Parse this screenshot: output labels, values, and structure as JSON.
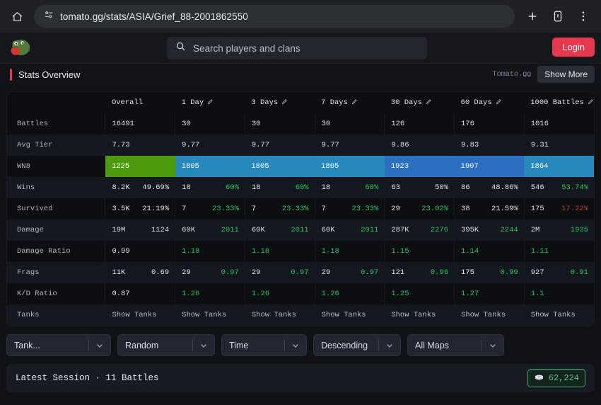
{
  "browser": {
    "url": "tomato.gg/stats/ASIA/Grief_88-2001862550",
    "home_icon": "home-icon",
    "site_settings_icon": "site-settings-icon",
    "new_tab_icon": "plus-icon",
    "reader_icon": "reader-mode-icon",
    "menu_icon": "kebab-menu-icon"
  },
  "header": {
    "logo_alt": "tomato-logo",
    "search_placeholder": "Search players and clans",
    "search_value": "",
    "search_icon": "search-icon",
    "login_label": "Login"
  },
  "subheader": {
    "title": "Stats Overview",
    "brand": "Tomato.gg",
    "show_more_label": "Show More"
  },
  "table": {
    "columns": [
      {
        "label": "",
        "editable": false
      },
      {
        "label": "Overall",
        "editable": false
      },
      {
        "label": "1 Day",
        "editable": true
      },
      {
        "label": "3 Days",
        "editable": true
      },
      {
        "label": "7 Days",
        "editable": true
      },
      {
        "label": "30 Days",
        "editable": true
      },
      {
        "label": "60 Days",
        "editable": true
      },
      {
        "label": "1000 Battles",
        "editable": true
      }
    ],
    "rows": [
      {
        "label": "Battles",
        "type": "plain",
        "cells": [
          {
            "left": "16491"
          },
          {
            "left": "30"
          },
          {
            "left": "30"
          },
          {
            "left": "30"
          },
          {
            "left": "126"
          },
          {
            "left": "176"
          },
          {
            "left": "1016"
          }
        ]
      },
      {
        "label": "Avg Tier",
        "type": "plain",
        "cells": [
          {
            "left": "7.73"
          },
          {
            "left": "9.77"
          },
          {
            "left": "9.77"
          },
          {
            "left": "9.77"
          },
          {
            "left": "9.86"
          },
          {
            "left": "9.83"
          },
          {
            "left": "9.31"
          }
        ]
      },
      {
        "label": "WN8",
        "type": "wn8",
        "cells": [
          {
            "left": "1225",
            "color": "#4c9b0c"
          },
          {
            "left": "1805",
            "color": "#2789bb"
          },
          {
            "left": "1805",
            "color": "#2789bb"
          },
          {
            "left": "1805",
            "color": "#2789bb"
          },
          {
            "left": "1923",
            "color": "#2a6fc0"
          },
          {
            "left": "1907",
            "color": "#2a6fc0"
          },
          {
            "left": "1864",
            "color": "#2789bb"
          }
        ]
      },
      {
        "label": "Wins",
        "type": "pair",
        "cells": [
          {
            "left": "8.2K",
            "right": "49.69%",
            "rcolor": "none"
          },
          {
            "left": "18",
            "right": "60%",
            "rcolor": "green"
          },
          {
            "left": "18",
            "right": "60%",
            "rcolor": "green"
          },
          {
            "left": "18",
            "right": "60%",
            "rcolor": "green"
          },
          {
            "left": "63",
            "right": "50%",
            "rcolor": "none"
          },
          {
            "left": "86",
            "right": "48.86%",
            "rcolor": "none"
          },
          {
            "left": "546",
            "right": "53.74%",
            "rcolor": "green"
          }
        ]
      },
      {
        "label": "Survived",
        "type": "pair",
        "cells": [
          {
            "left": "3.5K",
            "right": "21.19%",
            "rcolor": "none"
          },
          {
            "left": "7",
            "right": "23.33%",
            "rcolor": "green"
          },
          {
            "left": "7",
            "right": "23.33%",
            "rcolor": "green"
          },
          {
            "left": "7",
            "right": "23.33%",
            "rcolor": "green"
          },
          {
            "left": "29",
            "right": "23.02%",
            "rcolor": "green"
          },
          {
            "left": "38",
            "right": "21.59%",
            "rcolor": "none"
          },
          {
            "left": "175",
            "right": "17.22%",
            "rcolor": "red"
          }
        ]
      },
      {
        "label": "Damage",
        "type": "pair",
        "cells": [
          {
            "left": "19M",
            "right": "1124",
            "rcolor": "none"
          },
          {
            "left": "60K",
            "right": "2011",
            "rcolor": "green"
          },
          {
            "left": "60K",
            "right": "2011",
            "rcolor": "green"
          },
          {
            "left": "60K",
            "right": "2011",
            "rcolor": "green"
          },
          {
            "left": "287K",
            "right": "2276",
            "rcolor": "green"
          },
          {
            "left": "395K",
            "right": "2244",
            "rcolor": "green"
          },
          {
            "left": "2M",
            "right": "1935",
            "rcolor": "green"
          }
        ]
      },
      {
        "label": "Damage Ratio",
        "type": "pair",
        "cells": [
          {
            "left": "0.99",
            "right": "",
            "lcolor": "none"
          },
          {
            "left": "1.18",
            "right": "",
            "lcolor": "green"
          },
          {
            "left": "1.18",
            "right": "",
            "lcolor": "green"
          },
          {
            "left": "1.18",
            "right": "",
            "lcolor": "green"
          },
          {
            "left": "1.15",
            "right": "",
            "lcolor": "green"
          },
          {
            "left": "1.14",
            "right": "",
            "lcolor": "green"
          },
          {
            "left": "1.11",
            "right": "",
            "lcolor": "green"
          }
        ]
      },
      {
        "label": "Frags",
        "type": "pair",
        "cells": [
          {
            "left": "11K",
            "right": "0.69",
            "rcolor": "none"
          },
          {
            "left": "29",
            "right": "0.97",
            "rcolor": "green"
          },
          {
            "left": "29",
            "right": "0.97",
            "rcolor": "green"
          },
          {
            "left": "29",
            "right": "0.97",
            "rcolor": "green"
          },
          {
            "left": "121",
            "right": "0.96",
            "rcolor": "green"
          },
          {
            "left": "175",
            "right": "0.99",
            "rcolor": "green"
          },
          {
            "left": "927",
            "right": "0.91",
            "rcolor": "green"
          }
        ]
      },
      {
        "label": "K/D Ratio",
        "type": "pair",
        "cells": [
          {
            "left": "0.87",
            "right": "",
            "lcolor": "none"
          },
          {
            "left": "1.26",
            "right": "",
            "lcolor": "green"
          },
          {
            "left": "1.26",
            "right": "",
            "lcolor": "green"
          },
          {
            "left": "1.26",
            "right": "",
            "lcolor": "green"
          },
          {
            "left": "1.25",
            "right": "",
            "lcolor": "green"
          },
          {
            "left": "1.27",
            "right": "",
            "lcolor": "green"
          },
          {
            "left": "1.1",
            "right": "",
            "lcolor": "green"
          }
        ]
      },
      {
        "label": "Tanks",
        "type": "link",
        "cells": [
          {
            "left": "Show Tanks"
          },
          {
            "left": "Show Tanks"
          },
          {
            "left": "Show Tanks"
          },
          {
            "left": "Show Tanks"
          },
          {
            "left": "Show Tanks"
          },
          {
            "left": "Show Tanks"
          },
          {
            "left": "Show Tanks"
          }
        ]
      }
    ]
  },
  "filters": [
    {
      "name": "tank-filter",
      "value": "Tank..."
    },
    {
      "name": "mode-filter",
      "value": "Random"
    },
    {
      "name": "sort-filter",
      "value": "Time"
    },
    {
      "name": "order-filter",
      "value": "Descending"
    },
    {
      "name": "map-filter",
      "value": "All Maps"
    }
  ],
  "session": {
    "title": "Latest Session · 11 Battles",
    "credits": "62,224",
    "credits_icon": "silver-credits-icon"
  },
  "colors": {
    "accent_red": "#e8384f",
    "green": "#22c55e",
    "red": "#c0392b",
    "wn8_green": "#4c9b0c",
    "wn8_teal": "#2789bb",
    "wn8_blue": "#2a6fc0"
  }
}
